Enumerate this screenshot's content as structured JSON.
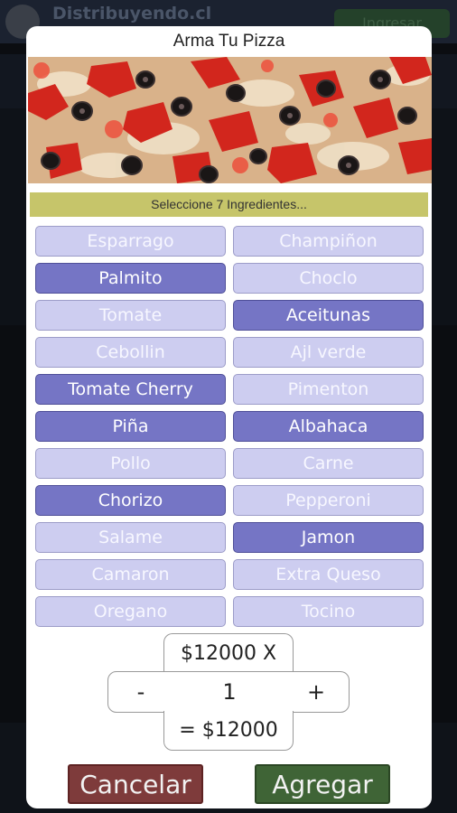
{
  "background": {
    "site_title": "Distribuyendo.cl",
    "login_label": "Ingresar"
  },
  "modal": {
    "title": "Arma Tu Pizza",
    "instructions": "Seleccione 7 Ingredientes...",
    "ingredients": [
      {
        "label": "Esparrago",
        "selected": false
      },
      {
        "label": "Champiñon",
        "selected": false
      },
      {
        "label": "Palmito",
        "selected": true
      },
      {
        "label": "Choclo",
        "selected": false
      },
      {
        "label": "Tomate",
        "selected": false
      },
      {
        "label": "Aceitunas",
        "selected": true
      },
      {
        "label": "Cebollin",
        "selected": false
      },
      {
        "label": "Ajl verde",
        "selected": false
      },
      {
        "label": "Tomate Cherry",
        "selected": true
      },
      {
        "label": "Pimenton",
        "selected": false
      },
      {
        "label": "Piña",
        "selected": true
      },
      {
        "label": "Albahaca",
        "selected": true
      },
      {
        "label": "Pollo",
        "selected": false
      },
      {
        "label": "Carne",
        "selected": false
      },
      {
        "label": "Chorizo",
        "selected": true
      },
      {
        "label": "Pepperoni",
        "selected": false
      },
      {
        "label": "Salame",
        "selected": false
      },
      {
        "label": "Jamon",
        "selected": true
      },
      {
        "label": "Camaron",
        "selected": false
      },
      {
        "label": "Extra Queso",
        "selected": false
      },
      {
        "label": "Oregano",
        "selected": false
      },
      {
        "label": "Tocino",
        "selected": false
      }
    ],
    "unit_price": "$12000 X",
    "quantity": "1",
    "minus_label": "-",
    "plus_label": "+",
    "total": "= $12000",
    "cancel_label": "Cancelar",
    "add_label": "Agregar"
  },
  "colors": {
    "selected": "#7575c5",
    "unselected": "#cdcdf0",
    "instructions_bar": "#c6c56a",
    "cancel": "#7e3b3b",
    "add": "#3f6436"
  }
}
